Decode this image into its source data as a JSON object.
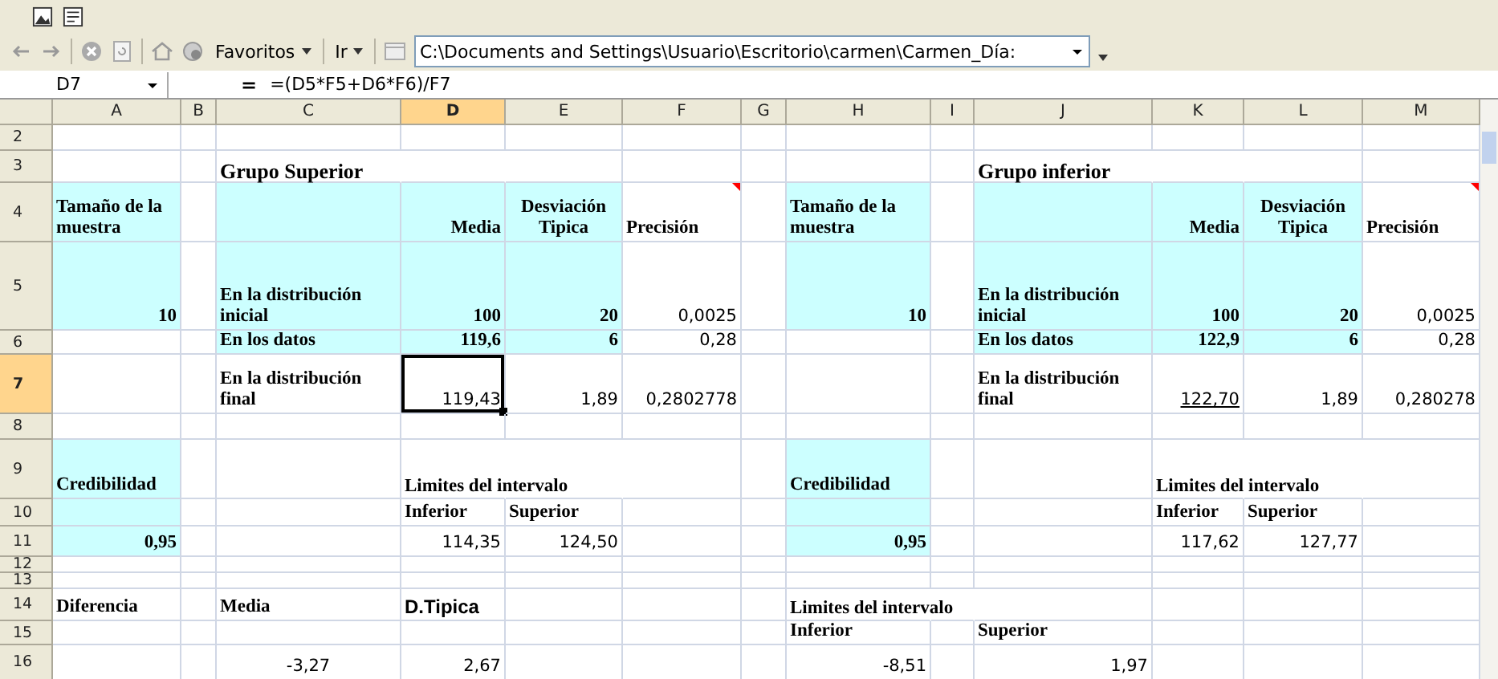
{
  "web_toolbar": {
    "favorites": "Favoritos",
    "go": "Ir",
    "address": "C:\\Documents and Settings\\Usuario\\Escritorio\\carmen\\Carmen_Día:"
  },
  "formula_bar": {
    "name_box": "D7",
    "equals": "=",
    "formula": "=(D5*F5+D6*F6)/F7"
  },
  "columns": [
    {
      "label": "A",
      "selected": false
    },
    {
      "label": "B",
      "selected": false
    },
    {
      "label": "C",
      "selected": false
    },
    {
      "label": "D",
      "selected": true
    },
    {
      "label": "E",
      "selected": false
    },
    {
      "label": "F",
      "selected": false
    },
    {
      "label": "G",
      "selected": false
    },
    {
      "label": "H",
      "selected": false
    },
    {
      "label": "I",
      "selected": false
    },
    {
      "label": "J",
      "selected": false
    },
    {
      "label": "K",
      "selected": false
    },
    {
      "label": "L",
      "selected": false
    },
    {
      "label": "M",
      "selected": false
    }
  ],
  "rows": [
    {
      "label": "2",
      "selected": false
    },
    {
      "label": "3",
      "selected": false,
      "cells": [
        {
          "shaded": false
        },
        {
          "shaded": false
        },
        {
          "kind": "title",
          "text": "Grupo Superior",
          "shaded": false
        },
        {
          "shaded": false
        },
        {
          "shaded": false
        },
        {
          "shaded": false
        },
        {
          "shaded": false
        },
        {
          "shaded": false
        },
        {
          "shaded": false
        },
        {
          "kind": "title",
          "text": "Grupo inferior",
          "shaded": false
        },
        {
          "shaded": false
        },
        {
          "shaded": false
        },
        {
          "shaded": false
        }
      ]
    },
    {
      "label": "4",
      "selected": false,
      "cells": [
        {
          "kind": "label",
          "text": "Tamaño de la muestra",
          "shaded": true
        },
        {
          "shaded": false
        },
        {
          "shaded": true
        },
        {
          "kind": "label_right",
          "text": "Media",
          "shaded": true
        },
        {
          "kind": "label_center",
          "text": "Desviación Tipica",
          "shaded": true
        },
        {
          "kind": "label",
          "text": "Precisión",
          "comment": true,
          "shaded": false
        },
        {
          "shaded": false
        },
        {
          "kind": "label",
          "text": "Tamaño de la muestra",
          "shaded": true
        },
        {
          "shaded": false
        },
        {
          "shaded": true
        },
        {
          "kind": "label_right",
          "text": "Media",
          "shaded": true
        },
        {
          "kind": "label_center",
          "text": "Desviación Tipica",
          "shaded": true
        },
        {
          "kind": "label",
          "text": "Precisión",
          "comment": true,
          "shaded": false
        }
      ]
    },
    {
      "label": "5",
      "selected": false,
      "cells": [
        {
          "kind": "value",
          "text": "10",
          "shaded": true
        },
        {
          "shaded": false
        },
        {
          "kind": "label",
          "text": "En la distribución inicial",
          "shaded": true
        },
        {
          "kind": "value",
          "text": "100",
          "shaded": true
        },
        {
          "kind": "value",
          "text": "20",
          "shaded": true
        },
        {
          "kind": "number",
          "text": "0,0025",
          "shaded": false
        },
        {
          "shaded": false
        },
        {
          "kind": "value",
          "text": "10",
          "shaded": true
        },
        {
          "shaded": false
        },
        {
          "kind": "label",
          "text": "En la distribución inicial",
          "shaded": true
        },
        {
          "kind": "value",
          "text": "100",
          "shaded": true
        },
        {
          "kind": "value",
          "text": "20",
          "shaded": true
        },
        {
          "kind": "number",
          "text": "0,0025",
          "shaded": false
        }
      ]
    },
    {
      "label": "6",
      "selected": false,
      "cells": [
        {
          "shaded": false
        },
        {
          "shaded": false
        },
        {
          "kind": "label",
          "text": "En los datos",
          "shaded": true
        },
        {
          "kind": "value",
          "text": "119,6",
          "shaded": true
        },
        {
          "kind": "value",
          "text": "6",
          "shaded": true
        },
        {
          "kind": "number",
          "text": "0,28",
          "shaded": false
        },
        {
          "shaded": false
        },
        {
          "shaded": false
        },
        {
          "shaded": false
        },
        {
          "kind": "label",
          "text": "En los datos",
          "shaded": true
        },
        {
          "kind": "value",
          "text": "122,9",
          "shaded": true
        },
        {
          "kind": "value",
          "text": "6",
          "shaded": true
        },
        {
          "kind": "number",
          "text": "0,28",
          "shaded": false
        }
      ]
    },
    {
      "label": "7",
      "selected": true,
      "cells": [
        {
          "shaded": false
        },
        {
          "shaded": false
        },
        {
          "kind": "label",
          "text": "En la distribución final",
          "shaded": false
        },
        {
          "kind": "number",
          "text": "119,43",
          "shaded": false
        },
        {
          "kind": "number",
          "text": "1,89",
          "shaded": false
        },
        {
          "kind": "number",
          "text": "0,2802778",
          "shaded": false
        },
        {
          "shaded": false
        },
        {
          "shaded": false
        },
        {
          "shaded": false
        },
        {
          "kind": "label",
          "text": "En la distribución final",
          "shaded": false
        },
        {
          "kind": "number",
          "text": "122,70",
          "underlined": true,
          "shaded": false
        },
        {
          "kind": "number",
          "text": "1,89",
          "shaded": false
        },
        {
          "kind": "number",
          "text": "0,280278",
          "shaded": false
        }
      ]
    },
    {
      "label": "8",
      "selected": false
    },
    {
      "label": "9",
      "selected": false,
      "cells": [
        {
          "kind": "label",
          "text": "Credibilidad",
          "shaded": true
        },
        {
          "shaded": false
        },
        {
          "shaded": false
        },
        {
          "kind": "label_overflow",
          "text": "Limites del intervalo",
          "shaded": false
        },
        {
          "shaded": false
        },
        {
          "shaded": false
        },
        {
          "shaded": false
        },
        {
          "kind": "label",
          "text": "Credibilidad",
          "shaded": true
        },
        {
          "shaded": false
        },
        {
          "shaded": false
        },
        {
          "kind": "label_overflow",
          "text": "Limites del intervalo",
          "shaded": false
        },
        {
          "shaded": false
        },
        {
          "shaded": false
        }
      ]
    },
    {
      "label": "10",
      "selected": false,
      "cells": [
        {
          "shaded": true
        },
        {
          "shaded": false
        },
        {
          "shaded": false
        },
        {
          "kind": "label",
          "text": "Inferior",
          "shaded": false
        },
        {
          "kind": "label",
          "text": "Superior",
          "shaded": false
        },
        {
          "shaded": false
        },
        {
          "shaded": false
        },
        {
          "shaded": true
        },
        {
          "shaded": false
        },
        {
          "shaded": false
        },
        {
          "kind": "label",
          "text": "Inferior",
          "shaded": false
        },
        {
          "kind": "label",
          "text": "Superior",
          "shaded": false
        },
        {
          "shaded": false
        }
      ]
    },
    {
      "label": "11",
      "selected": false,
      "cells": [
        {
          "kind": "value",
          "text": "0,95",
          "shaded": true
        },
        {
          "shaded": false
        },
        {
          "shaded": false
        },
        {
          "kind": "number",
          "text": "114,35",
          "shaded": false
        },
        {
          "kind": "number",
          "text": "124,50",
          "shaded": false
        },
        {
          "shaded": false
        },
        {
          "shaded": false
        },
        {
          "kind": "value",
          "text": "0,95",
          "shaded": true
        },
        {
          "shaded": false
        },
        {
          "shaded": false
        },
        {
          "kind": "number",
          "text": "117,62",
          "shaded": false
        },
        {
          "kind": "number",
          "text": "127,77",
          "shaded": false
        },
        {
          "shaded": false
        }
      ]
    },
    {
      "label": "12",
      "selected": false
    },
    {
      "label": "13",
      "selected": false
    },
    {
      "label": "14",
      "selected": false,
      "cells": [
        {
          "kind": "label",
          "text": "Diferencia",
          "shaded": false
        },
        {
          "shaded": false
        },
        {
          "kind": "label",
          "text": "Media",
          "shaded": false
        },
        {
          "kind": "heading",
          "text": "D.Tipica",
          "shaded": false
        },
        {
          "shaded": false
        },
        {
          "shaded": false
        },
        {
          "shaded": false
        },
        {
          "kind": "label_overflow",
          "text": "Limites del intervalo",
          "shaded": false
        },
        {
          "shaded": false
        },
        {
          "shaded": false
        },
        {
          "shaded": false
        },
        {
          "shaded": false
        },
        {
          "shaded": false
        }
      ]
    },
    {
      "label": "15",
      "selected": false,
      "cells": [
        {
          "shaded": false
        },
        {
          "shaded": false
        },
        {
          "shaded": false
        },
        {
          "shaded": false
        },
        {
          "shaded": false
        },
        {
          "shaded": false
        },
        {
          "shaded": false
        },
        {
          "kind": "label",
          "text": "Inferior",
          "shaded": false
        },
        {
          "shaded": false
        },
        {
          "kind": "label",
          "text": "Superior",
          "shaded": false
        },
        {
          "shaded": false
        },
        {
          "shaded": false
        },
        {
          "shaded": false
        }
      ]
    },
    {
      "label": "16",
      "selected": false,
      "cells": [
        {
          "shaded": false
        },
        {
          "shaded": false
        },
        {
          "kind": "number_center",
          "text": "-3,27",
          "shaded": false
        },
        {
          "kind": "number",
          "text": "2,67",
          "shaded": false
        },
        {
          "shaded": false
        },
        {
          "shaded": false
        },
        {
          "shaded": false
        },
        {
          "kind": "number",
          "text": "-8,51",
          "shaded": false
        },
        {
          "shaded": false
        },
        {
          "kind": "number",
          "text": "1,97",
          "shaded": false
        },
        {
          "shaded": false
        },
        {
          "shaded": false
        },
        {
          "shaded": false
        }
      ]
    }
  ]
}
